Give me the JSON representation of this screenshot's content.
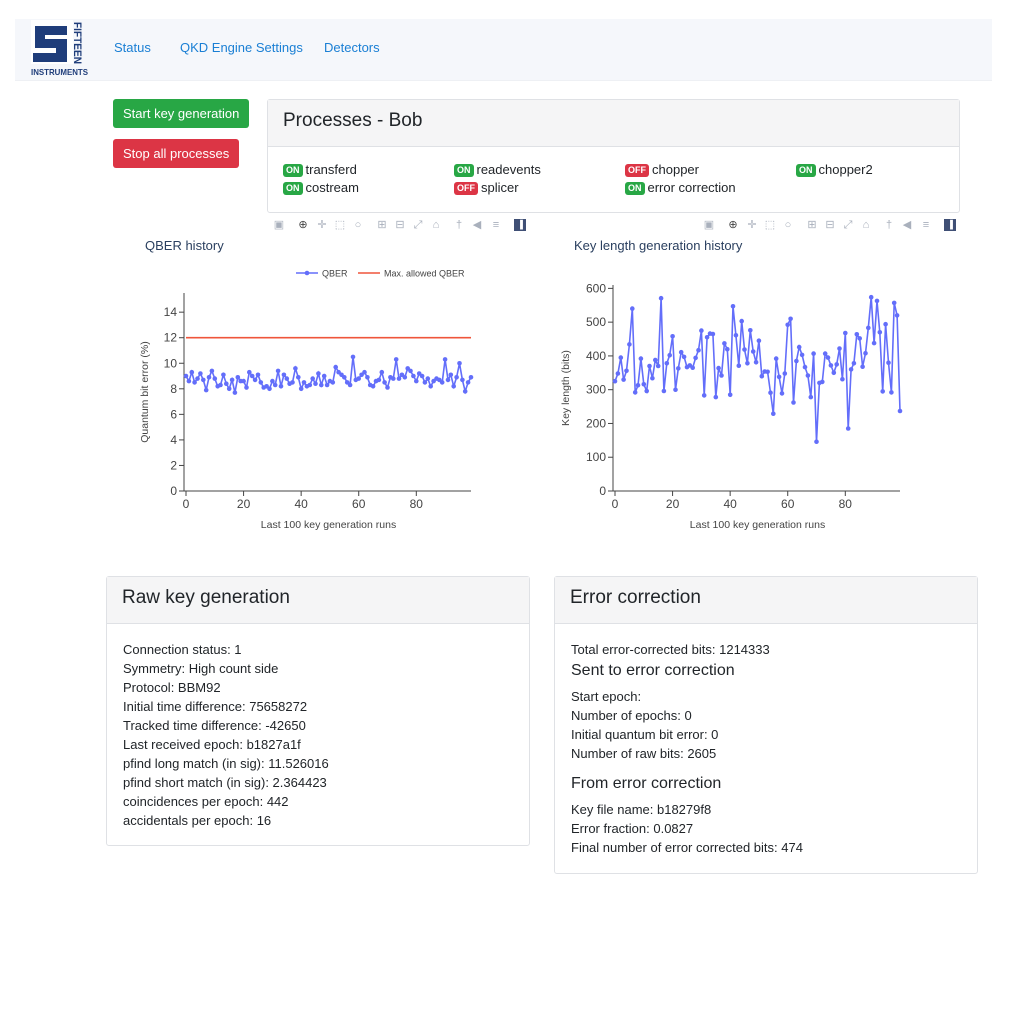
{
  "nav": {
    "logo_text": "FIFTEEN INSTRUMENTS",
    "links": [
      "Status",
      "QKD Engine Settings",
      "Detectors"
    ]
  },
  "buttons": {
    "start": "Start key generation",
    "stop": "Stop all processes"
  },
  "processes": {
    "title": "Processes - Bob",
    "items": [
      {
        "name": "transferd",
        "state": "ON"
      },
      {
        "name": "readevents",
        "state": "ON"
      },
      {
        "name": "chopper",
        "state": "OFF"
      },
      {
        "name": "chopper2",
        "state": "ON"
      },
      {
        "name": "costream",
        "state": "ON"
      },
      {
        "name": "splicer",
        "state": "OFF"
      },
      {
        "name": "error correction",
        "state": "ON"
      }
    ]
  },
  "toolbar_icons": [
    "camera-icon",
    "zoom-icon",
    "pan-icon",
    "box-select-icon",
    "lasso-select-icon",
    "zoom-in-icon",
    "zoom-out-icon",
    "autoscale-icon",
    "reset-axes-icon",
    "spike-lines-icon",
    "hover-closest-icon",
    "hover-compare-icon",
    "plotly-logo-icon"
  ],
  "chart_data": [
    {
      "type": "line",
      "title": "QBER history",
      "xlabel": "Last 100 key generation runs",
      "ylabel": "Quantum bit error (%)",
      "xlim": [
        0,
        99
      ],
      "ylim": [
        0,
        15.5
      ],
      "xticks": [
        0,
        20,
        40,
        60,
        80
      ],
      "yticks": [
        0,
        2,
        4,
        6,
        8,
        10,
        12,
        14
      ],
      "legend_position": "top-right",
      "series": [
        {
          "name": "QBER",
          "color": "#636efa",
          "x": [
            0,
            1,
            2,
            3,
            4,
            5,
            6,
            7,
            8,
            9,
            10,
            11,
            12,
            13,
            14,
            15,
            16,
            17,
            18,
            19,
            20,
            21,
            22,
            23,
            24,
            25,
            26,
            27,
            28,
            29,
            30,
            31,
            32,
            33,
            34,
            35,
            36,
            37,
            38,
            39,
            40,
            41,
            42,
            43,
            44,
            45,
            46,
            47,
            48,
            49,
            50,
            51,
            52,
            53,
            54,
            55,
            56,
            57,
            58,
            59,
            60,
            61,
            62,
            63,
            64,
            65,
            66,
            67,
            68,
            69,
            70,
            71,
            72,
            73,
            74,
            75,
            76,
            77,
            78,
            79,
            80,
            81,
            82,
            83,
            84,
            85,
            86,
            87,
            88,
            89,
            90,
            91,
            92,
            93,
            94,
            95,
            96,
            97,
            98,
            99
          ],
          "values": [
            9.0,
            8.6,
            9.3,
            8.5,
            8.8,
            9.2,
            8.7,
            7.9,
            8.9,
            9.4,
            8.8,
            8.2,
            8.3,
            9.1,
            8.4,
            8.0,
            8.7,
            7.7,
            8.9,
            8.6,
            8.6,
            8.1,
            9.3,
            9.0,
            8.7,
            9.1,
            8.5,
            8.1,
            8.2,
            8.0,
            8.6,
            8.3,
            9.4,
            8.2,
            9.1,
            8.8,
            8.4,
            8.5,
            9.6,
            8.9,
            8.0,
            8.5,
            8.2,
            8.3,
            8.8,
            8.4,
            9.2,
            8.3,
            9.0,
            8.3,
            8.6,
            8.5,
            9.7,
            9.3,
            9.1,
            8.9,
            8.5,
            8.3,
            10.5,
            8.7,
            8.8,
            9.1,
            9.3,
            8.9,
            8.3,
            8.2,
            8.6,
            8.7,
            9.3,
            8.5,
            8.1,
            8.9,
            8.8,
            10.3,
            8.8,
            9.1,
            8.9,
            9.6,
            9.4,
            9.0,
            8.6,
            9.2,
            9.0,
            8.5,
            8.8,
            8.2,
            8.6,
            8.8,
            8.7,
            8.5,
            10.3,
            8.7,
            9.1,
            8.2,
            8.9,
            10.0,
            8.7,
            7.8,
            8.5,
            8.9
          ]
        },
        {
          "name": "Max. allowed QBER",
          "color": "#ef553b",
          "x": [
            0,
            99
          ],
          "values": [
            12,
            12
          ]
        }
      ]
    },
    {
      "type": "line",
      "title": "Key length generation history",
      "xlabel": "Last 100 key generation runs",
      "ylabel": "Key length (bits)",
      "xlim": [
        0,
        99
      ],
      "ylim": [
        0,
        610
      ],
      "xticks": [
        0,
        20,
        40,
        60,
        80
      ],
      "yticks": [
        0,
        100,
        200,
        300,
        400,
        500,
        600
      ],
      "series": [
        {
          "name": "Key length",
          "color": "#636efa",
          "x": [
            0,
            1,
            2,
            3,
            4,
            5,
            6,
            7,
            8,
            9,
            10,
            11,
            12,
            13,
            14,
            15,
            16,
            17,
            18,
            19,
            20,
            21,
            22,
            23,
            24,
            25,
            26,
            27,
            28,
            29,
            30,
            31,
            32,
            33,
            34,
            35,
            36,
            37,
            38,
            39,
            40,
            41,
            42,
            43,
            44,
            45,
            46,
            47,
            48,
            49,
            50,
            51,
            52,
            53,
            54,
            55,
            56,
            57,
            58,
            59,
            60,
            61,
            62,
            63,
            64,
            65,
            66,
            67,
            68,
            69,
            70,
            71,
            72,
            73,
            74,
            75,
            76,
            77,
            78,
            79,
            80,
            81,
            82,
            83,
            84,
            85,
            86,
            87,
            88,
            89,
            90,
            91,
            92,
            93,
            94,
            95,
            96,
            97,
            98,
            99
          ],
          "values": [
            325,
            348,
            395,
            330,
            356,
            434,
            540,
            292,
            313,
            392,
            316,
            296,
            370,
            334,
            388,
            370,
            571,
            296,
            378,
            402,
            458,
            300,
            363,
            411,
            397,
            367,
            372,
            365,
            394,
            417,
            475,
            283,
            455,
            466,
            465,
            278,
            364,
            342,
            437,
            420,
            285,
            547,
            461,
            371,
            503,
            419,
            378,
            476,
            413,
            381,
            445,
            340,
            354,
            353,
            291,
            229,
            392,
            338,
            289,
            348,
            492,
            510,
            262,
            385,
            426,
            403,
            367,
            342,
            278,
            407,
            146,
            320,
            323,
            407,
            395,
            372,
            350,
            375,
            422,
            331,
            468,
            185,
            360,
            378,
            464,
            452,
            368,
            408,
            483,
            574,
            438,
            563,
            470,
            295,
            494,
            380,
            292,
            557,
            520,
            237
          ]
        }
      ]
    }
  ],
  "raw_key": {
    "title": "Raw key generation",
    "lines": [
      "Connection status: 1",
      "Symmetry: High count side",
      "Protocol: BBM92",
      "Initial time difference: 75658272",
      "Tracked time difference: -42650",
      "Last received epoch: b1827a1f",
      "pfind long match (in sig): 11.526016",
      "pfind short match (in sig): 2.364423",
      "coincidences per epoch: 442",
      "accidentals per epoch: 16"
    ]
  },
  "error_correction": {
    "title": "Error correction",
    "total": "Total error-corrected bits: 1214333",
    "sent_title": "Sent to error correction",
    "sent_lines": [
      "Start epoch:",
      "Number of epochs: 0",
      "Initial quantum bit error: 0",
      "Number of raw bits: 2605"
    ],
    "from_title": "From error correction",
    "from_lines": [
      "Key file name: b18279f8",
      "Error fraction: 0.0827",
      "Final number of error corrected bits: 474"
    ]
  },
  "colors": {
    "nav_link": "#1a7fd4",
    "success": "#28a745",
    "danger": "#dc3545",
    "trace": "#636efa",
    "threshold": "#ef553b",
    "logo_blue": "#1f3d7a"
  }
}
